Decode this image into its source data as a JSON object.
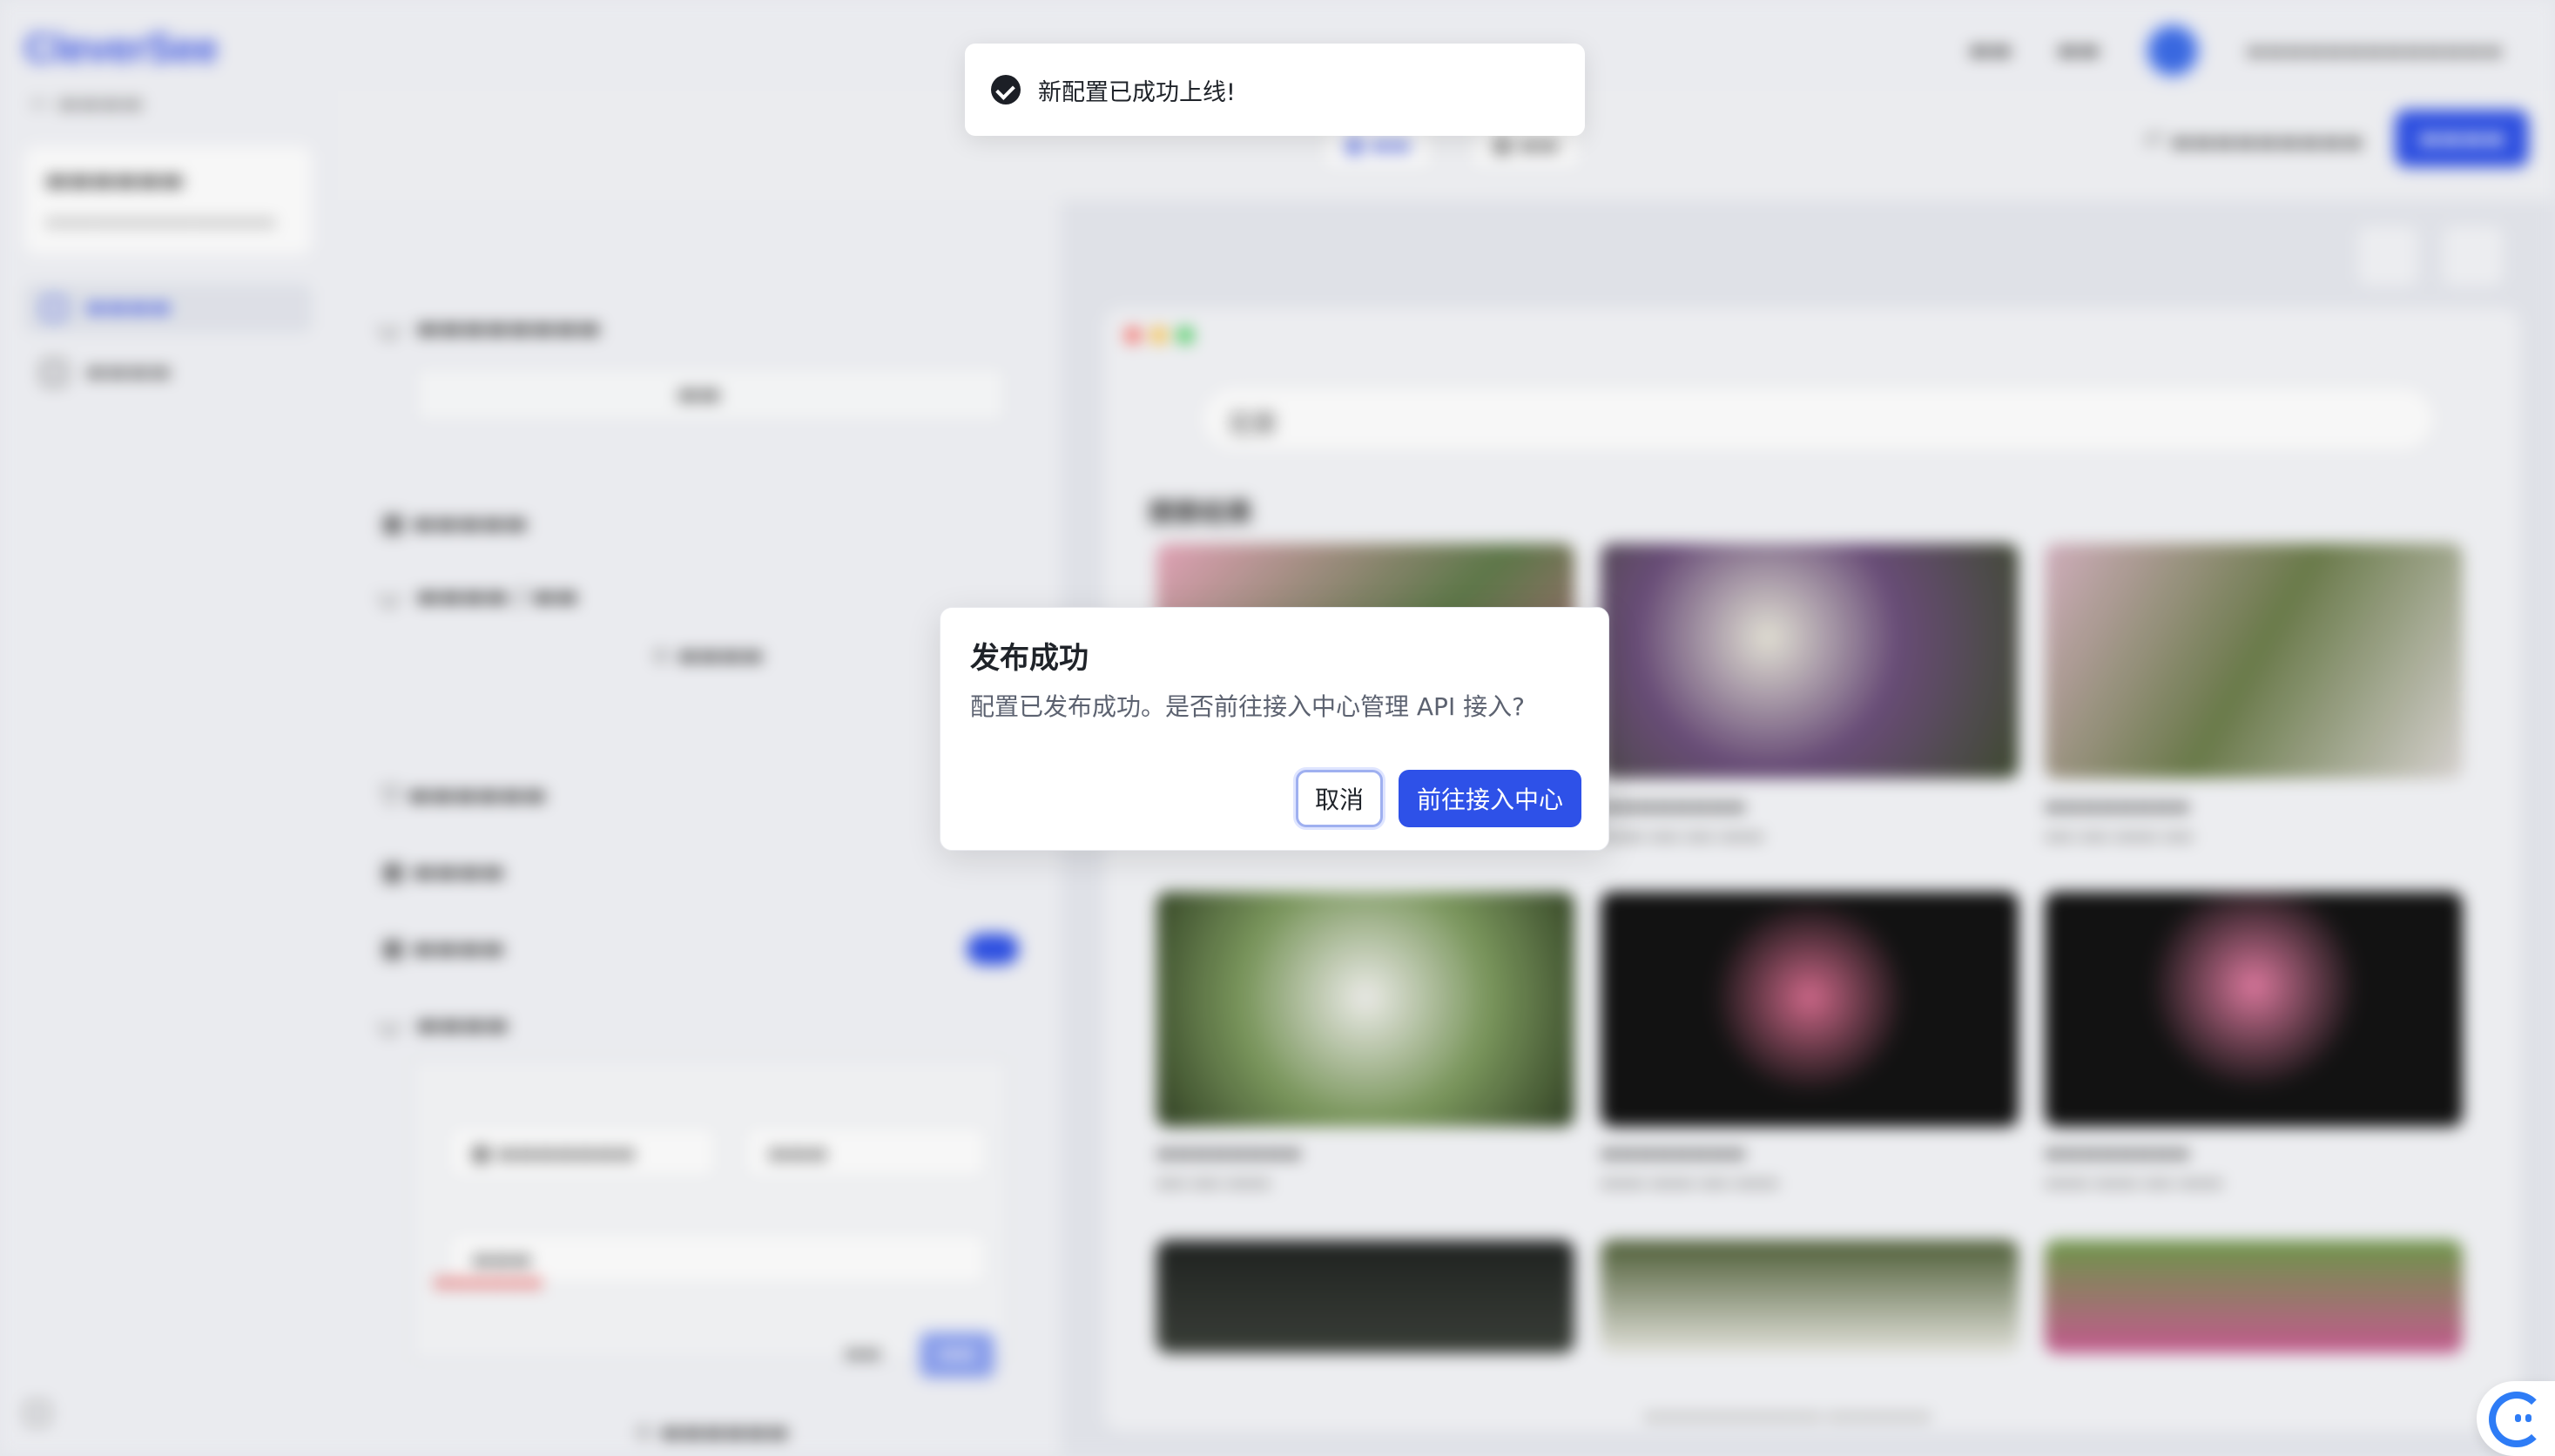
{
  "toast": {
    "message": "新配置已成功上线!"
  },
  "dialog": {
    "title": "发布成功",
    "message": "配置已发布成功。是否前往接入中心管理 API 接入?",
    "cancel_label": "取消",
    "confirm_label": "前往接入中心"
  },
  "colors": {
    "primary": "#2e51e8",
    "toast_icon": "#1c1f26",
    "error": "#e64545"
  },
  "icons": {
    "toast": "check-circle-icon",
    "help": "assistant-chat-icon"
  },
  "background": {
    "logo": "CleverSee",
    "preview": {
      "search_query": "花草",
      "results_title": "搜索结果"
    }
  }
}
